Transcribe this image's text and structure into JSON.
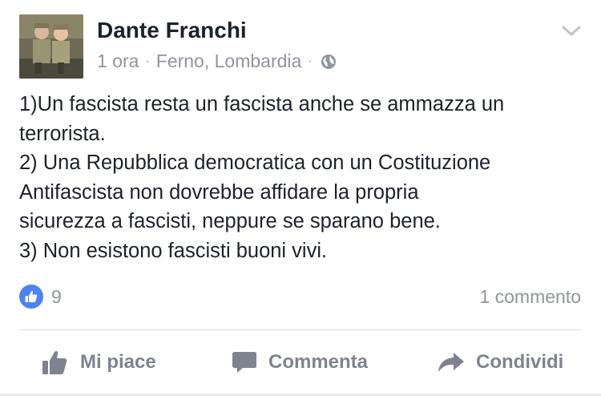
{
  "post": {
    "author": "Dante Franchi",
    "time": "1 ora",
    "location": "Ferno, Lombardia",
    "separator": "·",
    "privacy_icon": "globe-icon",
    "menu_icon": "chevron-down-icon",
    "body_lines": [
      "1)Un fascista resta un fascista anche se ammazza un",
      "terrorista.",
      "2) Una Repubblica democratica con un Costituzione",
      "Antifascista non dovrebbe affidare la propria",
      "sicurezza a fascisti, neppure se sparano bene.",
      "3) Non esistono fascisti buoni vivi."
    ]
  },
  "stats": {
    "like_count": "9",
    "comments": "1 commento"
  },
  "actions": {
    "like": "Mi piace",
    "comment": "Commenta",
    "share": "Condividi"
  },
  "colors": {
    "text": "#1d2129",
    "muted": "#90949c",
    "like_blue": "#4d82f3",
    "action_gray": "#7f8390"
  }
}
